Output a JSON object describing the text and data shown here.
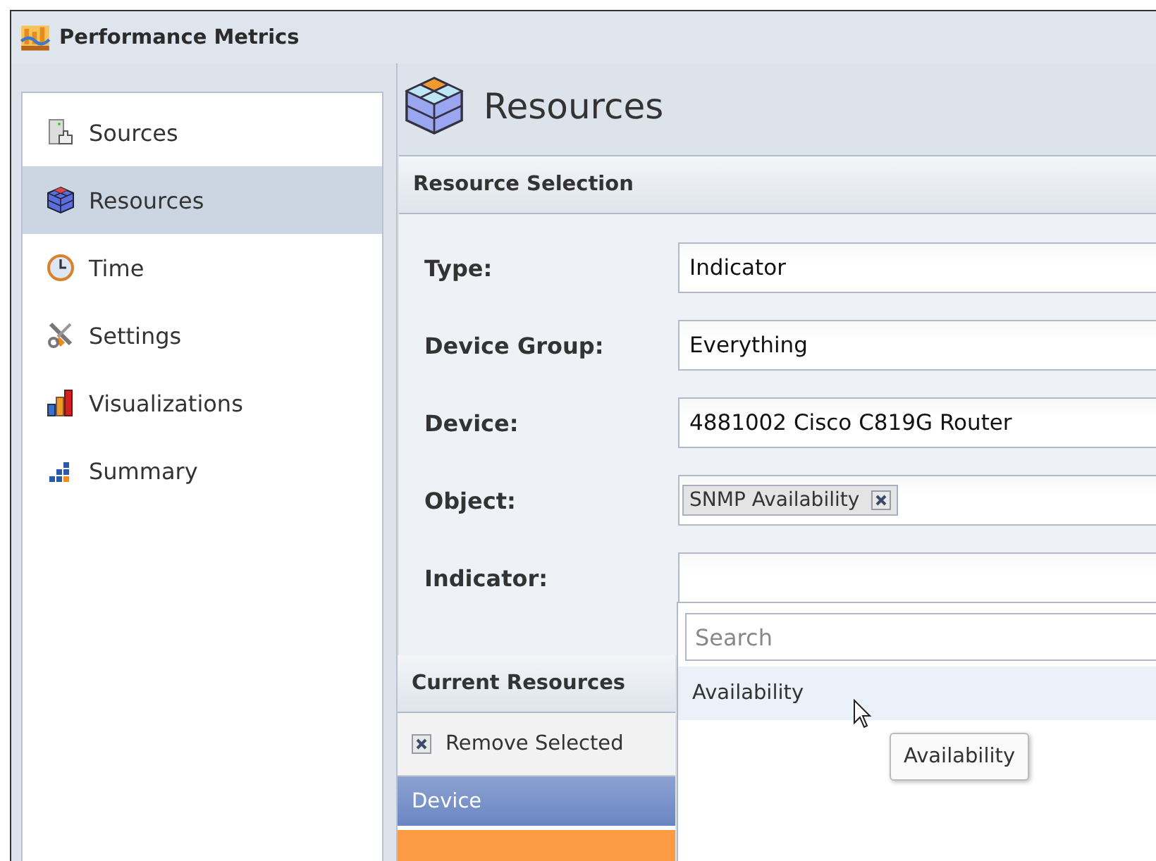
{
  "window": {
    "title": "Performance Metrics"
  },
  "sidebar": {
    "items": [
      {
        "label": "Sources",
        "selected": false
      },
      {
        "label": "Resources",
        "selected": true
      },
      {
        "label": "Time",
        "selected": false
      },
      {
        "label": "Settings",
        "selected": false
      },
      {
        "label": "Visualizations",
        "selected": false
      },
      {
        "label": "Summary",
        "selected": false
      }
    ]
  },
  "page_title": "Resources",
  "resource_selection": {
    "title": "Resource Selection",
    "fields": [
      {
        "kind": "text",
        "label": "Type:",
        "value": "Indicator"
      },
      {
        "kind": "text",
        "label": "Device Group:",
        "value": "Everything"
      },
      {
        "kind": "text",
        "label": "Device:",
        "value": "4881002 Cisco C819G Router"
      },
      {
        "kind": "tags",
        "label": "Object:",
        "tags": [
          "SNMP Availability"
        ]
      },
      {
        "kind": "text",
        "label": "Indicator:"
      }
    ]
  },
  "dropdown": {
    "search": {
      "placeholder": "Search"
    },
    "options": [
      {
        "label": "Availability",
        "highlighted": true
      }
    ],
    "tooltip": "Availability"
  },
  "current_resources": {
    "title": "Current Resources",
    "toolbar": [
      {
        "label": "Remove Selected"
      }
    ],
    "columns": [
      "Device"
    ],
    "rows": [
      {
        "selected": true
      }
    ]
  }
}
